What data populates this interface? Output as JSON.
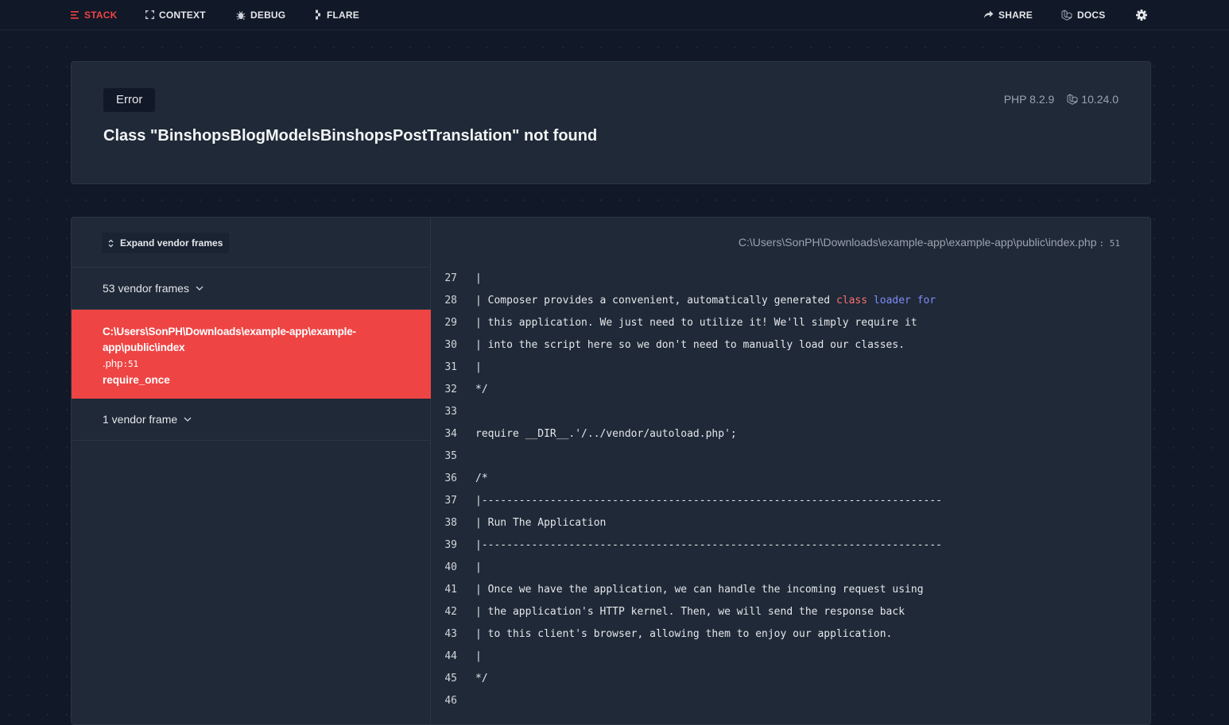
{
  "nav": {
    "stack": "STACK",
    "context": "CONTEXT",
    "debug": "DEBUG",
    "flare": "FLARE",
    "share": "SHARE",
    "docs": "DOCS"
  },
  "error": {
    "type": "Error",
    "message": "Class \"BinshopsBlogModelsBinshopsPostTranslation\" not found",
    "php_version": "PHP 8.2.9",
    "laravel_version": "10.24.0"
  },
  "frames": {
    "expand_label": "Expand vendor frames",
    "vendor_group_1": "53 vendor frames",
    "selected": {
      "path_line1": "C:\\Users\\SonPH\\Downloads\\example-app\\example-",
      "path_line2": "app\\public\\index",
      "ext": ".php",
      "line": "51",
      "method": "require_once"
    },
    "vendor_group_2": "1 vendor frame"
  },
  "code": {
    "file_path": "C:\\Users\\SonPH\\Downloads\\example-app\\example-app\\public\\index.php",
    "file_line": "51",
    "lines": [
      {
        "n": "27",
        "t": "|"
      },
      {
        "n": "28",
        "a": "| Composer provides a convenient, automatically generated ",
        "b": "class",
        "c": " loader for"
      },
      {
        "n": "29",
        "t": "| this application. We just need to utilize it! We'll simply require it"
      },
      {
        "n": "30",
        "t": "| into the script here so we don't need to manually load our classes."
      },
      {
        "n": "31",
        "t": "|"
      },
      {
        "n": "32",
        "t": "*/"
      },
      {
        "n": "33",
        "t": ""
      },
      {
        "n": "34",
        "t": "require __DIR__.'/../vendor/autoload.php';"
      },
      {
        "n": "35",
        "t": ""
      },
      {
        "n": "36",
        "t": "/*"
      },
      {
        "n": "37",
        "t": "|--------------------------------------------------------------------------"
      },
      {
        "n": "38",
        "t": "| Run The Application"
      },
      {
        "n": "39",
        "t": "|--------------------------------------------------------------------------"
      },
      {
        "n": "40",
        "t": "|"
      },
      {
        "n": "41",
        "t": "| Once we have the application, we can handle the incoming request using"
      },
      {
        "n": "42",
        "t": "| the application's HTTP kernel. Then, we will send the response back"
      },
      {
        "n": "43",
        "t": "| to this client's browser, allowing them to enjoy our application."
      },
      {
        "n": "44",
        "t": "|"
      },
      {
        "n": "45",
        "t": "*/"
      },
      {
        "n": "46",
        "t": ""
      }
    ]
  },
  "icons": {
    "stack": "list-icon",
    "context": "expand-icon",
    "debug": "bug-icon",
    "flare": "flare-icon",
    "share": "share-arrow-icon",
    "docs": "laravel-icon",
    "settings": "gear-icon"
  },
  "colors": {
    "background": "#111827",
    "card": "#1f2937",
    "accent_red": "#ef4444",
    "comment": "#818cf8"
  }
}
